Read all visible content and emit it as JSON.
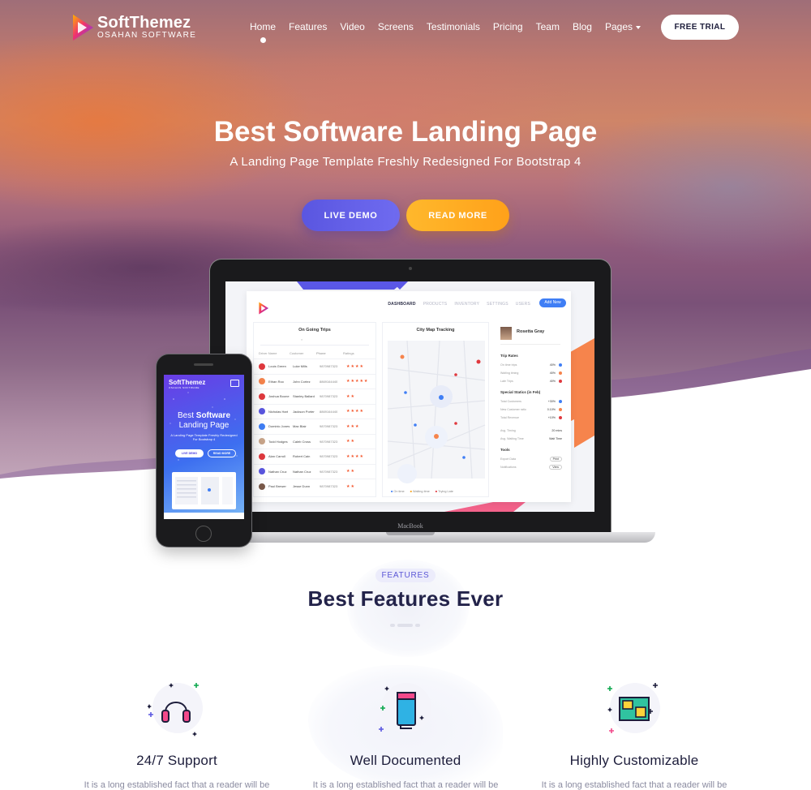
{
  "brand": {
    "name": "SoftThemez",
    "sub": "OSAHAN SOFTWARE"
  },
  "nav": {
    "items": [
      {
        "label": "Home",
        "active": true
      },
      {
        "label": "Features"
      },
      {
        "label": "Video"
      },
      {
        "label": "Screens"
      },
      {
        "label": "Testimonials"
      },
      {
        "label": "Pricing"
      },
      {
        "label": "Team"
      },
      {
        "label": "Blog"
      },
      {
        "label": "Pages",
        "dropdown": true
      }
    ],
    "cta": "FREE TRIAL"
  },
  "hero": {
    "title_pre": "Best ",
    "title_bold": "Software",
    "title_post": " Landing Page",
    "subtitle": "A Landing Page Template Freshly Redesigned For Bootstrap 4",
    "btn_primary": "LIVE DEMO",
    "btn_secondary": "READ MORE"
  },
  "laptop": {
    "brand": "MacBook",
    "dashboard": {
      "nav": [
        "DASHBOARD",
        "PRODUCTS",
        "INVENTORY",
        "SETTINGS",
        "USERS"
      ],
      "add_button": "Add New",
      "trips_title": "On Going Trips",
      "trips_headers": [
        "Driver Name",
        "Customer",
        "Phone",
        "Ratings"
      ],
      "trips": [
        {
          "driver": "Louis Green",
          "customer": "Luke Mills",
          "phone": "9870987323",
          "stars": "★★★★"
        },
        {
          "driver": "Ethan Roo",
          "customer": "John Cortez",
          "phone": "8869164440",
          "stars": "★★★★★"
        },
        {
          "driver": "Joshua Boone",
          "customer": "Stanley Ballard",
          "phone": "9870987323",
          "stars": "★★"
        },
        {
          "driver": "Nicholas Hart",
          "customer": "Jackson Porter",
          "phone": "8869164440",
          "stars": "★★★★"
        },
        {
          "driver": "Dominic Jones",
          "customer": "Max Blair",
          "phone": "9870987323",
          "stars": "★★★"
        },
        {
          "driver": "Todd Hodges",
          "customer": "Caleb Cross",
          "phone": "9870987323",
          "stars": "★★"
        },
        {
          "driver": "Alan Carroll",
          "customer": "Robert Cain",
          "phone": "9870987323",
          "stars": "★★★★"
        },
        {
          "driver": "Nathan Cruz",
          "customer": "Nathan Cruz",
          "phone": "9870987323",
          "stars": "★★"
        },
        {
          "driver": "Paul Brewer",
          "customer": "Jesse Dunn",
          "phone": "9870987323",
          "stars": "★★"
        }
      ],
      "map_title": "City Map Tracking",
      "map_legend": [
        "On time",
        "Waiting time",
        "Trying Late"
      ],
      "profile_name": "Rosetta Gray",
      "trip_rates_title": "Trip Rates",
      "trip_rates": [
        {
          "label": "On time trips",
          "value": "40%"
        },
        {
          "label": "Waiting timing",
          "value": "40%"
        },
        {
          "label": "Late Trips",
          "value": "40%"
        }
      ],
      "special_title": "Special Statics (in Feb)",
      "special": [
        {
          "label": "Total Customers",
          "value": "+30%"
        },
        {
          "label": "New Customer ratio",
          "value": "0.10%"
        },
        {
          "label": "Total Revenue",
          "value": "+10%"
        }
      ],
      "avg": [
        {
          "label": "Avg. Timing",
          "value": "20 mins"
        },
        {
          "label": "Avg. Waiting Time",
          "value": "Wait Time"
        }
      ],
      "tools_title": "Tools",
      "tools": [
        {
          "label": "Export Data",
          "btn": "Print"
        },
        {
          "label": "Notifications",
          "btn": "View"
        }
      ]
    }
  },
  "phone": {
    "logo": "SoftThemez",
    "logo_sub": "OSAHAN SOFTWARE",
    "title_bold": "Software",
    "title_pre": "Best ",
    "title_line2": "Landing Page",
    "subtitle": "A Landing Page Template Freshly Redesigned For Bootstrap 4",
    "btn1": "LIVE DEMO",
    "btn2": "READ MORE"
  },
  "features": {
    "badge": "FEATURES",
    "title": "Best Features Ever",
    "items": [
      {
        "icon": "headphones-icon",
        "name": "24/7 Support",
        "text": "It is a long established fact that a reader will be"
      },
      {
        "icon": "book-icon",
        "name": "Well Documented",
        "text": "It is a long established fact that a reader will be"
      },
      {
        "icon": "layout-icon",
        "name": "Highly Customizable",
        "text": "It is a long established fact that a reader will be"
      }
    ]
  },
  "colors": {
    "primary": "#5a56e0",
    "secondary": "#ffa11a",
    "dark": "#1d1d3b"
  }
}
